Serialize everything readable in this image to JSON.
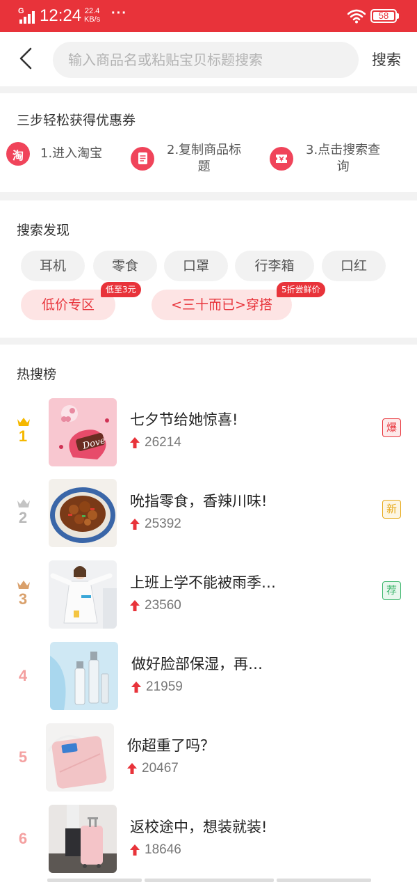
{
  "status_bar": {
    "network": "G",
    "time": "12:24",
    "speed_value": "22.4",
    "speed_unit": "KB/s",
    "more": "···",
    "battery_level": "58"
  },
  "header": {
    "search_placeholder": "输入商品名或粘贴宝贝标题搜索",
    "search_button": "搜索"
  },
  "steps": {
    "title": "三步轻松获得优惠券",
    "items": [
      {
        "icon": "taobao-icon",
        "icon_text": "淘",
        "label": "1.进入淘宝"
      },
      {
        "icon": "document-copy-icon",
        "label_line1": "2.复制商品标",
        "label_line2": "题"
      },
      {
        "icon": "ticket-search-icon",
        "label_line1": "3.点击搜索查",
        "label_line2": "询"
      }
    ]
  },
  "discover": {
    "title": "搜索发现",
    "chips": [
      "耳机",
      "零食",
      "口罩",
      "行李箱",
      "口红"
    ],
    "hot_chips": [
      {
        "label": "低价专区",
        "badge": "低至3元"
      },
      {
        "label": "<三十而已>穿搭",
        "badge": "5折尝鲜价"
      }
    ]
  },
  "hot_list": {
    "title": "热搜榜",
    "items": [
      {
        "rank": "1",
        "title": "七夕节给她惊喜!",
        "heat": "26214",
        "tag": "爆",
        "tag_color": "#e8333a",
        "rank_color": "#f5b800",
        "thumb": "dove-chocolate-image"
      },
      {
        "rank": "2",
        "title": "吮指零食，香辣川味!",
        "heat": "25392",
        "tag": "新",
        "tag_color": "#e6a817",
        "rank_color": "#b8b8b8",
        "thumb": "spicy-food-image"
      },
      {
        "rank": "3",
        "title": "上班上学不能被雨季…",
        "heat": "23560",
        "tag": "荐",
        "tag_color": "#3bb56b",
        "rank_color": "#d9a06b",
        "thumb": "raincoat-girl-image"
      },
      {
        "rank": "4",
        "title": "做好脸部保湿，再…",
        "heat": "21959",
        "tag": "",
        "rank_color": "#f4a0a0",
        "thumb": "skincare-bottles-image"
      },
      {
        "rank": "5",
        "title": "你超重了吗？",
        "heat": "20467",
        "tag": "",
        "rank_color": "#f4a0a0",
        "thumb": "pink-scale-image"
      },
      {
        "rank": "6",
        "title": "返校途中，想装就装!",
        "heat": "18646",
        "tag": "",
        "rank_color": "#f4a0a0",
        "thumb": "pink-luggage-image"
      }
    ]
  },
  "colors": {
    "brand_red": "#e8333a",
    "chip_bg": "#f2f2f2",
    "hot_chip_bg": "#fde4e4"
  }
}
